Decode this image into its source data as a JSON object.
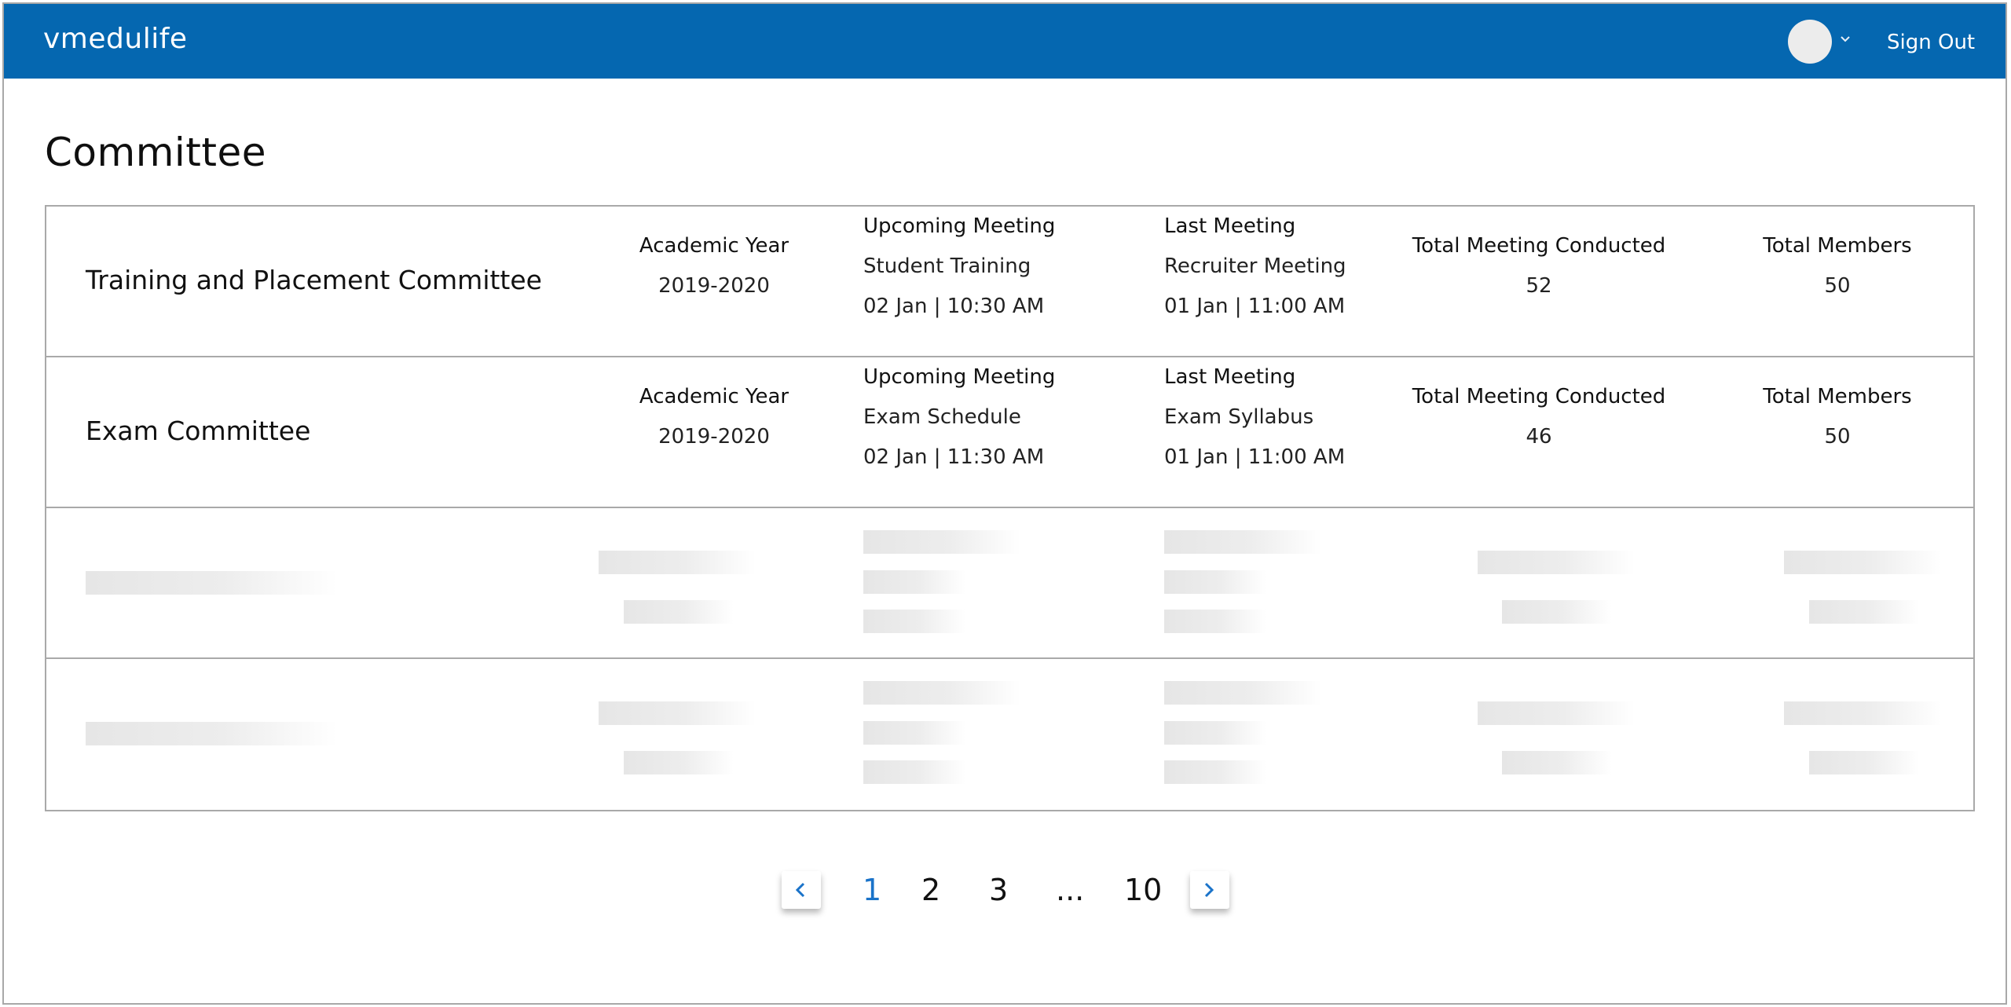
{
  "app": {
    "brand": "vmedulife",
    "sign_out": "Sign Out"
  },
  "page": {
    "title": "Committee"
  },
  "committees": [
    {
      "name": "Training and Placement Committee",
      "academic_year_label": "Academic Year",
      "academic_year": "2019-2020",
      "upcoming_label": "Upcoming Meeting",
      "upcoming_title": "Student Training",
      "upcoming_time": "02 Jan | 10:30 AM",
      "last_label": "Last Meeting",
      "last_title": "Recruiter Meeting",
      "last_time": "01 Jan | 11:00 AM",
      "conducted_label": "Total Meeting Conducted",
      "conducted": "52",
      "members_label": "Total Members",
      "members": "50"
    },
    {
      "name": "Exam Committee",
      "academic_year_label": "Academic Year",
      "academic_year": "2019-2020",
      "upcoming_label": "Upcoming Meeting",
      "upcoming_title": "Exam Schedule",
      "upcoming_time": "02 Jan | 11:30 AM",
      "last_label": "Last Meeting",
      "last_title": "Exam Syllabus",
      "last_time": "01 Jan | 11:00 AM",
      "conducted_label": "Total Meeting Conducted",
      "conducted": "46",
      "members_label": "Total Members",
      "members": "50"
    }
  ],
  "pagination": {
    "pages": [
      "1",
      "2",
      "3",
      "...",
      "10"
    ],
    "active": "1"
  },
  "colors": {
    "header": "#0567b0",
    "accent": "#1a73c9",
    "border": "#a9a9a9"
  },
  "icons": {
    "prev": "chevron-left-icon",
    "next": "chevron-right-icon",
    "dropdown": "chevron-down-icon"
  }
}
